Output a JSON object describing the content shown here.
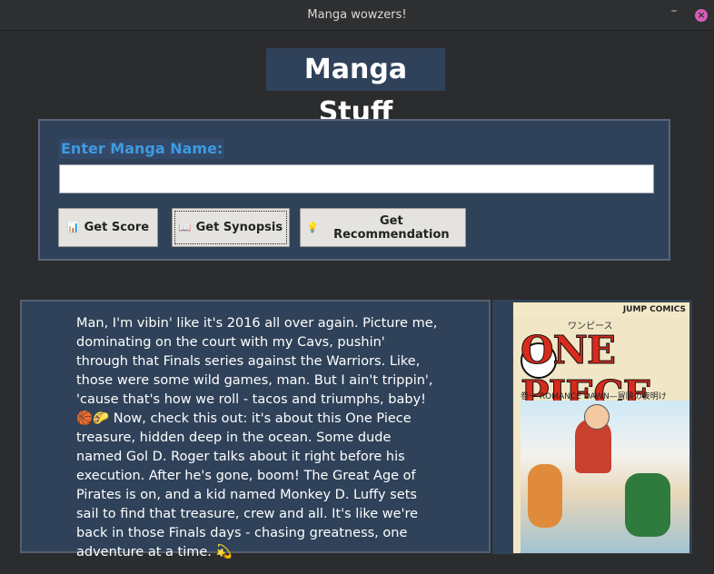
{
  "window": {
    "title": "Manga wowzers!"
  },
  "header": {
    "title": "Manga Stuff"
  },
  "form": {
    "label": "Enter Manga Name:",
    "input_value": "",
    "buttons": {
      "score": {
        "icon": "📊",
        "label": "Get Score"
      },
      "synopsis": {
        "icon": "📖",
        "label": "Get Synopsis"
      },
      "recommendation": {
        "icon": "💡",
        "label": "Get Recommendation"
      }
    }
  },
  "output": {
    "text": "Man, I'm vibin' like it's 2016 all over again. Picture me, dominating on the court with my Cavs, pushin' through that Finals series against the Warriors. Like, those were some wild games, man. But I ain't trippin', 'cause that's how we roll - tacos and triumphs, baby! 🏀🌮 Now, check this out: it's about this One Piece treasure, hidden deep in the ocean. Some dude named Gol D. Roger talks about it right before his execution. After he's gone, boom! The Great Age of Pirates is on, and a kid named Monkey D. Luffy sets sail to find that treasure, crew and all. It's like we're back in those Finals days - chasing greatness, one adventure at a time. 💫"
  },
  "cover": {
    "top": "JUMP COMICS",
    "kana": "ワンピース",
    "logo": "ONE PIECE",
    "volume": "巻一",
    "subtitle": "ROMANCE DAWN—冒険の夜明け"
  },
  "colors": {
    "panel": "#2f4259",
    "accent": "#3d9be0",
    "background": "#2b2c2e"
  }
}
